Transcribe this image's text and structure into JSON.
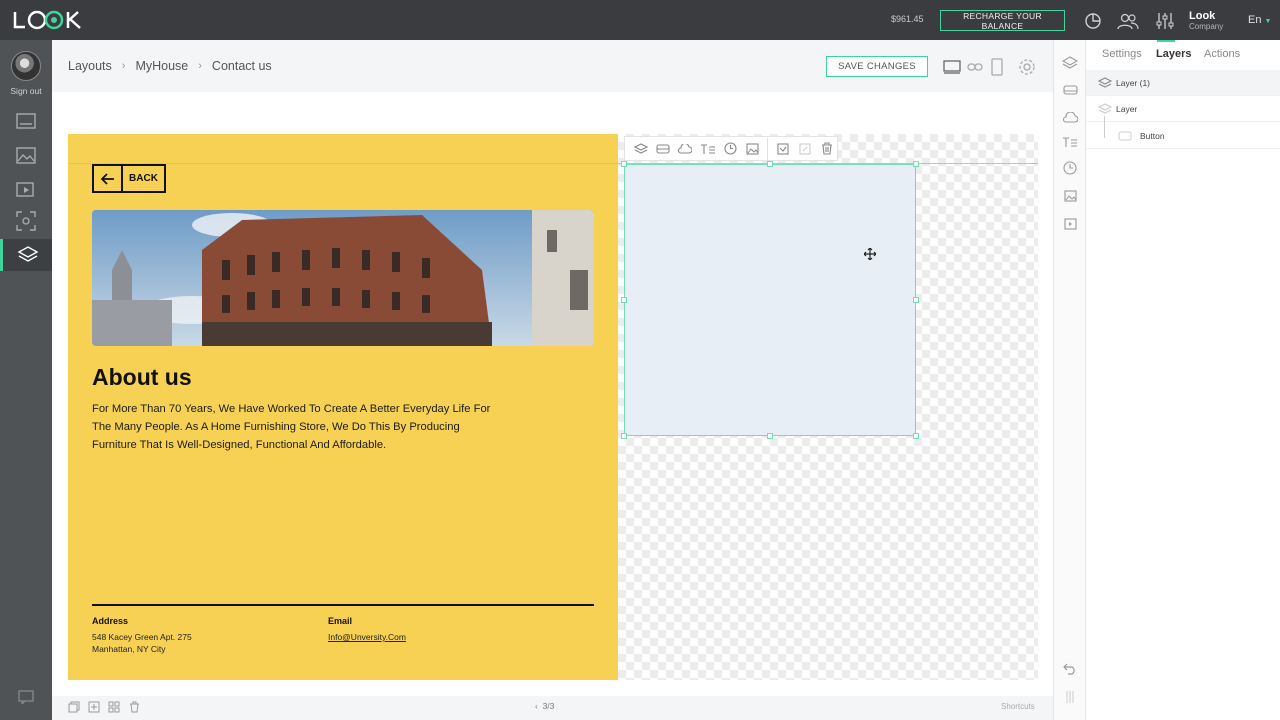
{
  "topbar": {
    "balance": "$961.45",
    "recharge_label": "RECHARGE YOUR BALANCE",
    "account_name": "Look",
    "account_sub": "Company",
    "language": "En"
  },
  "sidebar": {
    "signout_label": "Sign out"
  },
  "header": {
    "breadcrumb": [
      "Layouts",
      "MyHouse",
      "Contact us"
    ],
    "save_label": "SAVE CHANGES"
  },
  "canvas": {
    "back_label": "BACK",
    "about_title": "About us",
    "about_text": "For More Than 70 Years, We Have Worked To Create A Better Everyday Life For The Many People. As A Home Furnishing Store, We Do This By Producing Furniture That Is Well-Designed, Functional And Affordable.",
    "address_label": "Address",
    "address_line1": "548 Kacey Green Apt. 275",
    "address_line2": "Manhattan, NY City",
    "email_label": "Email",
    "email_value": "Info@Unversity.Com"
  },
  "bottombar": {
    "pager": "3/3",
    "shortcuts": "Shortcuts"
  },
  "panel": {
    "tabs": [
      "Settings",
      "Layers",
      "Actions"
    ],
    "active_tab": "Layers",
    "layers": [
      {
        "label": "Layer (1)"
      },
      {
        "label": "Layer"
      },
      {
        "label": "Button"
      }
    ]
  },
  "colors": {
    "accent": "#3fd49a",
    "topbar": "#3a3c3f",
    "page_yellow": "#f7d154",
    "selection_fill": "#e8eef6"
  }
}
